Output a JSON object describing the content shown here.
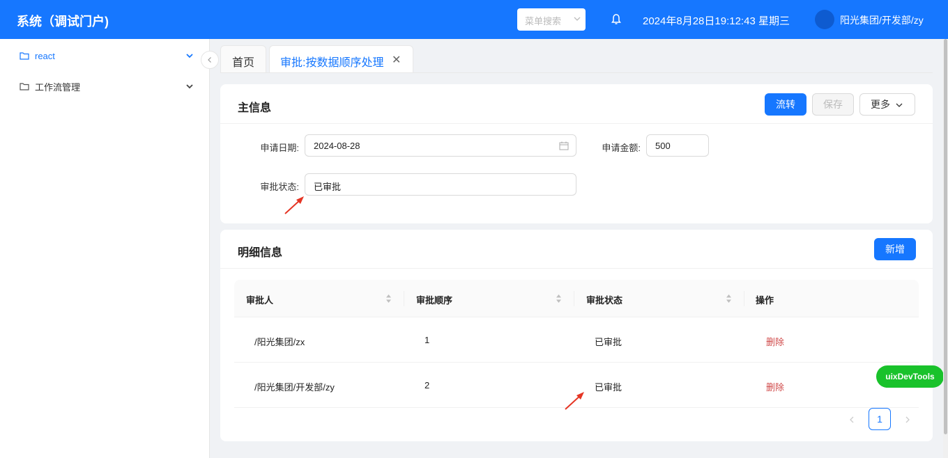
{
  "header": {
    "title": "系统（调试门户)",
    "menu_search_placeholder": "菜单搜索",
    "datetime": "2024年8月28日19:12:43 星期三",
    "user": "阳光集团/开发部/zy",
    "icons": [
      "bell-icon",
      "avatar",
      "chevron-down-icon"
    ]
  },
  "sidebar": {
    "items": [
      {
        "label": "react",
        "icon": "folder-icon",
        "active": true
      },
      {
        "label": "工作流管理",
        "icon": "folder-icon",
        "active": false
      }
    ]
  },
  "tabs": [
    {
      "label": "首页",
      "active": false
    },
    {
      "label": "审批:按数据顺序处理",
      "active": true
    }
  ],
  "main_info": {
    "title": "主信息",
    "buttons": {
      "flow": "流转",
      "save": "保存",
      "more": "更多"
    },
    "fields": {
      "apply_date_label": "申请日期:",
      "apply_date_value": "2024-08-28",
      "amount_label": "申请金额:",
      "amount_value": "500",
      "status_label": "审批状态:",
      "status_value": "已审批"
    }
  },
  "detail_info": {
    "title": "明细信息",
    "add_button": "新增",
    "columns": [
      "审批人",
      "审批顺序",
      "审批状态",
      "操作"
    ],
    "rows": [
      {
        "approver": "/阳光集团/zx",
        "order": "1",
        "status": "已审批",
        "action": "删除"
      },
      {
        "approver": "/阳光集团/开发部/zy",
        "order": "2",
        "status": "已审批",
        "action": "删除"
      }
    ]
  },
  "pagination": {
    "current": "1"
  },
  "devtools_label": "uixDevTools",
  "colors": {
    "primary": "#1677ff",
    "danger": "#d04a4a",
    "devtools": "#19c22b",
    "annotation": "#e53524"
  }
}
